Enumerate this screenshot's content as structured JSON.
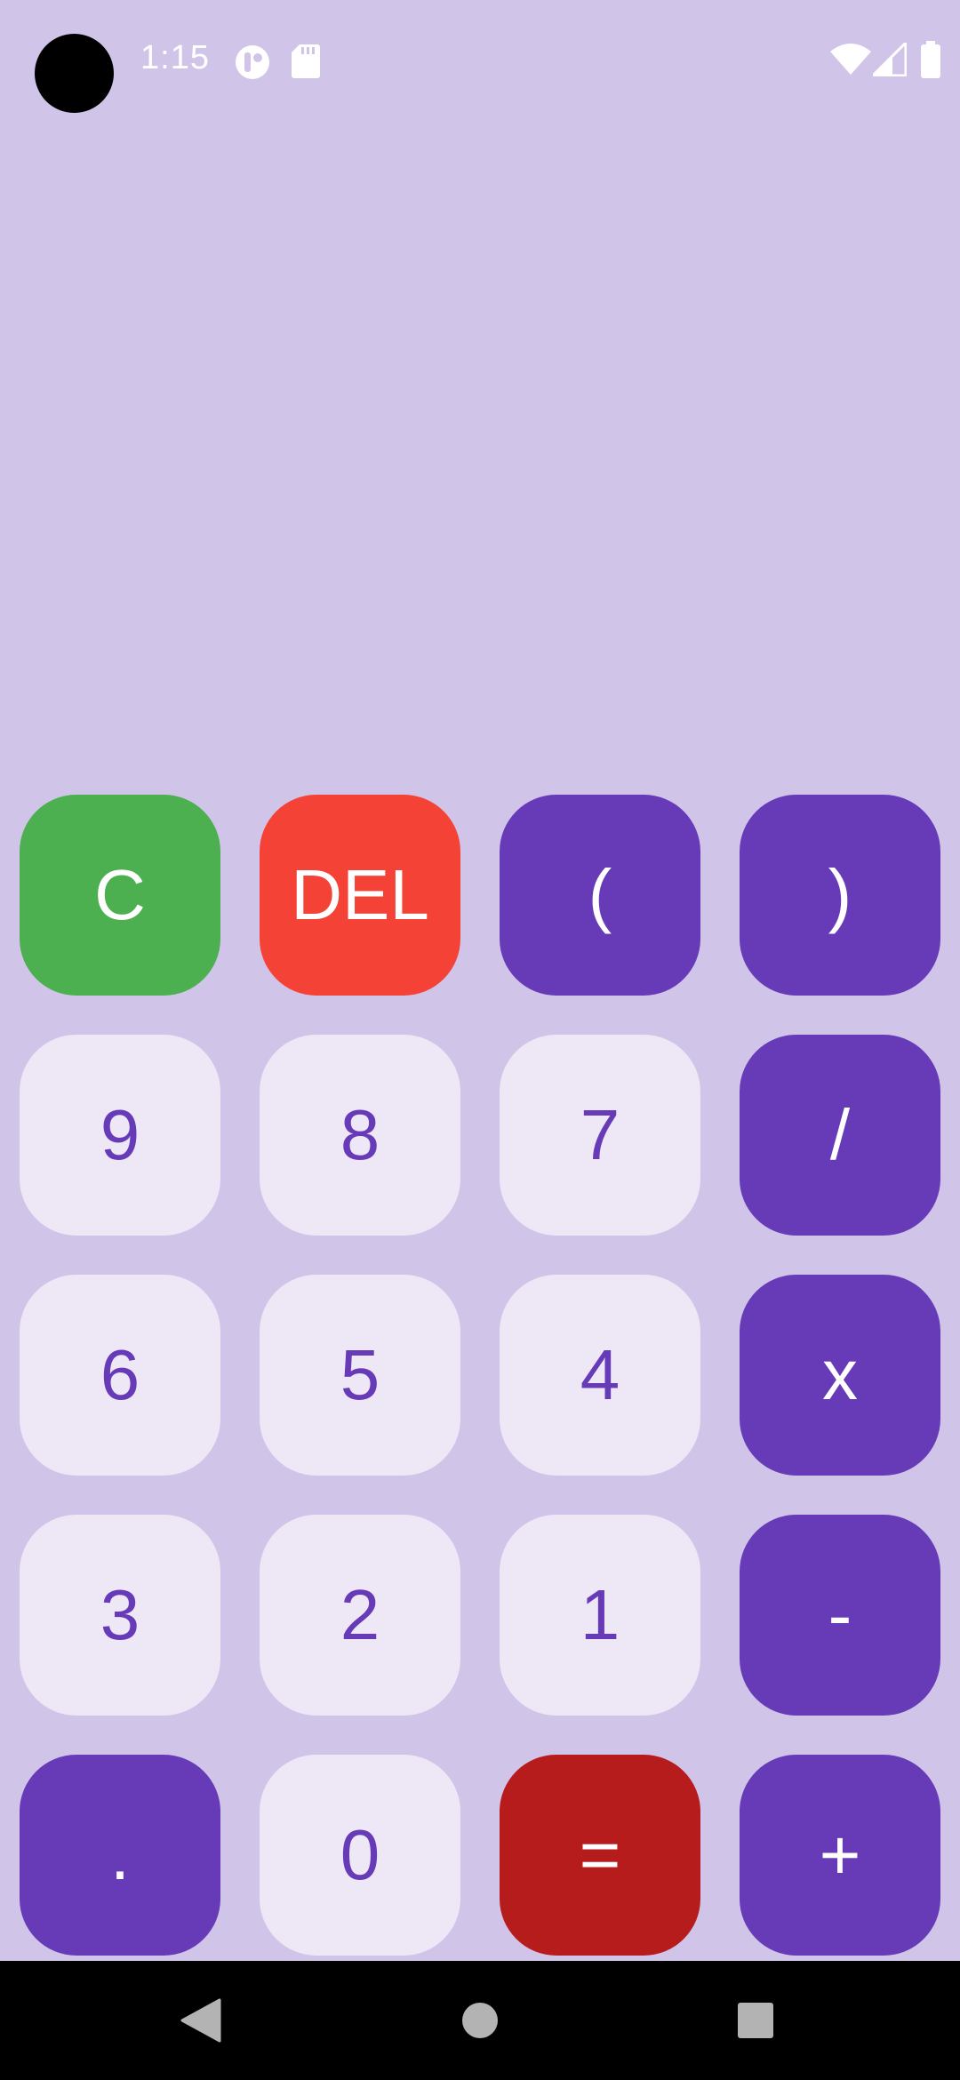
{
  "status_bar": {
    "time": "1:15",
    "icons": [
      "notification-app-icon",
      "sd-card-icon",
      "wifi-icon",
      "cellular-signal-icon",
      "battery-icon"
    ]
  },
  "display": {
    "expression": ""
  },
  "keypad": {
    "rows": [
      [
        {
          "label": "C",
          "kind": "clear",
          "name": "clear-button"
        },
        {
          "label": "DEL",
          "kind": "delete",
          "name": "delete-button"
        },
        {
          "label": "(",
          "kind": "operator",
          "name": "open-paren-button"
        },
        {
          "label": ")",
          "kind": "operator",
          "name": "close-paren-button"
        }
      ],
      [
        {
          "label": "9",
          "kind": "digit",
          "name": "digit-9-button"
        },
        {
          "label": "8",
          "kind": "digit",
          "name": "digit-8-button"
        },
        {
          "label": "7",
          "kind": "digit",
          "name": "digit-7-button"
        },
        {
          "label": "/",
          "kind": "operator",
          "name": "divide-button"
        }
      ],
      [
        {
          "label": "6",
          "kind": "digit",
          "name": "digit-6-button"
        },
        {
          "label": "5",
          "kind": "digit",
          "name": "digit-5-button"
        },
        {
          "label": "4",
          "kind": "digit",
          "name": "digit-4-button"
        },
        {
          "label": "x",
          "kind": "operator",
          "name": "multiply-button"
        }
      ],
      [
        {
          "label": "3",
          "kind": "digit",
          "name": "digit-3-button"
        },
        {
          "label": "2",
          "kind": "digit",
          "name": "digit-2-button"
        },
        {
          "label": "1",
          "kind": "digit",
          "name": "digit-1-button"
        },
        {
          "label": "-",
          "kind": "operator",
          "name": "subtract-button"
        }
      ],
      [
        {
          "label": ".",
          "kind": "operator",
          "name": "decimal-point-button"
        },
        {
          "label": "0",
          "kind": "digit",
          "name": "digit-0-button"
        },
        {
          "label": "=",
          "kind": "equals",
          "name": "equals-button"
        },
        {
          "label": "+",
          "kind": "operator",
          "name": "add-button"
        }
      ]
    ]
  },
  "colors": {
    "background": "#d1c4e9",
    "clear": "#4caf50",
    "delete": "#f44336",
    "operator": "#673ab7",
    "digit_bg": "#ede7f6",
    "digit_text": "#673ab7",
    "equals": "#b71c1c"
  },
  "nav_bar": {
    "buttons": [
      "back-icon",
      "home-icon",
      "recents-icon"
    ]
  }
}
